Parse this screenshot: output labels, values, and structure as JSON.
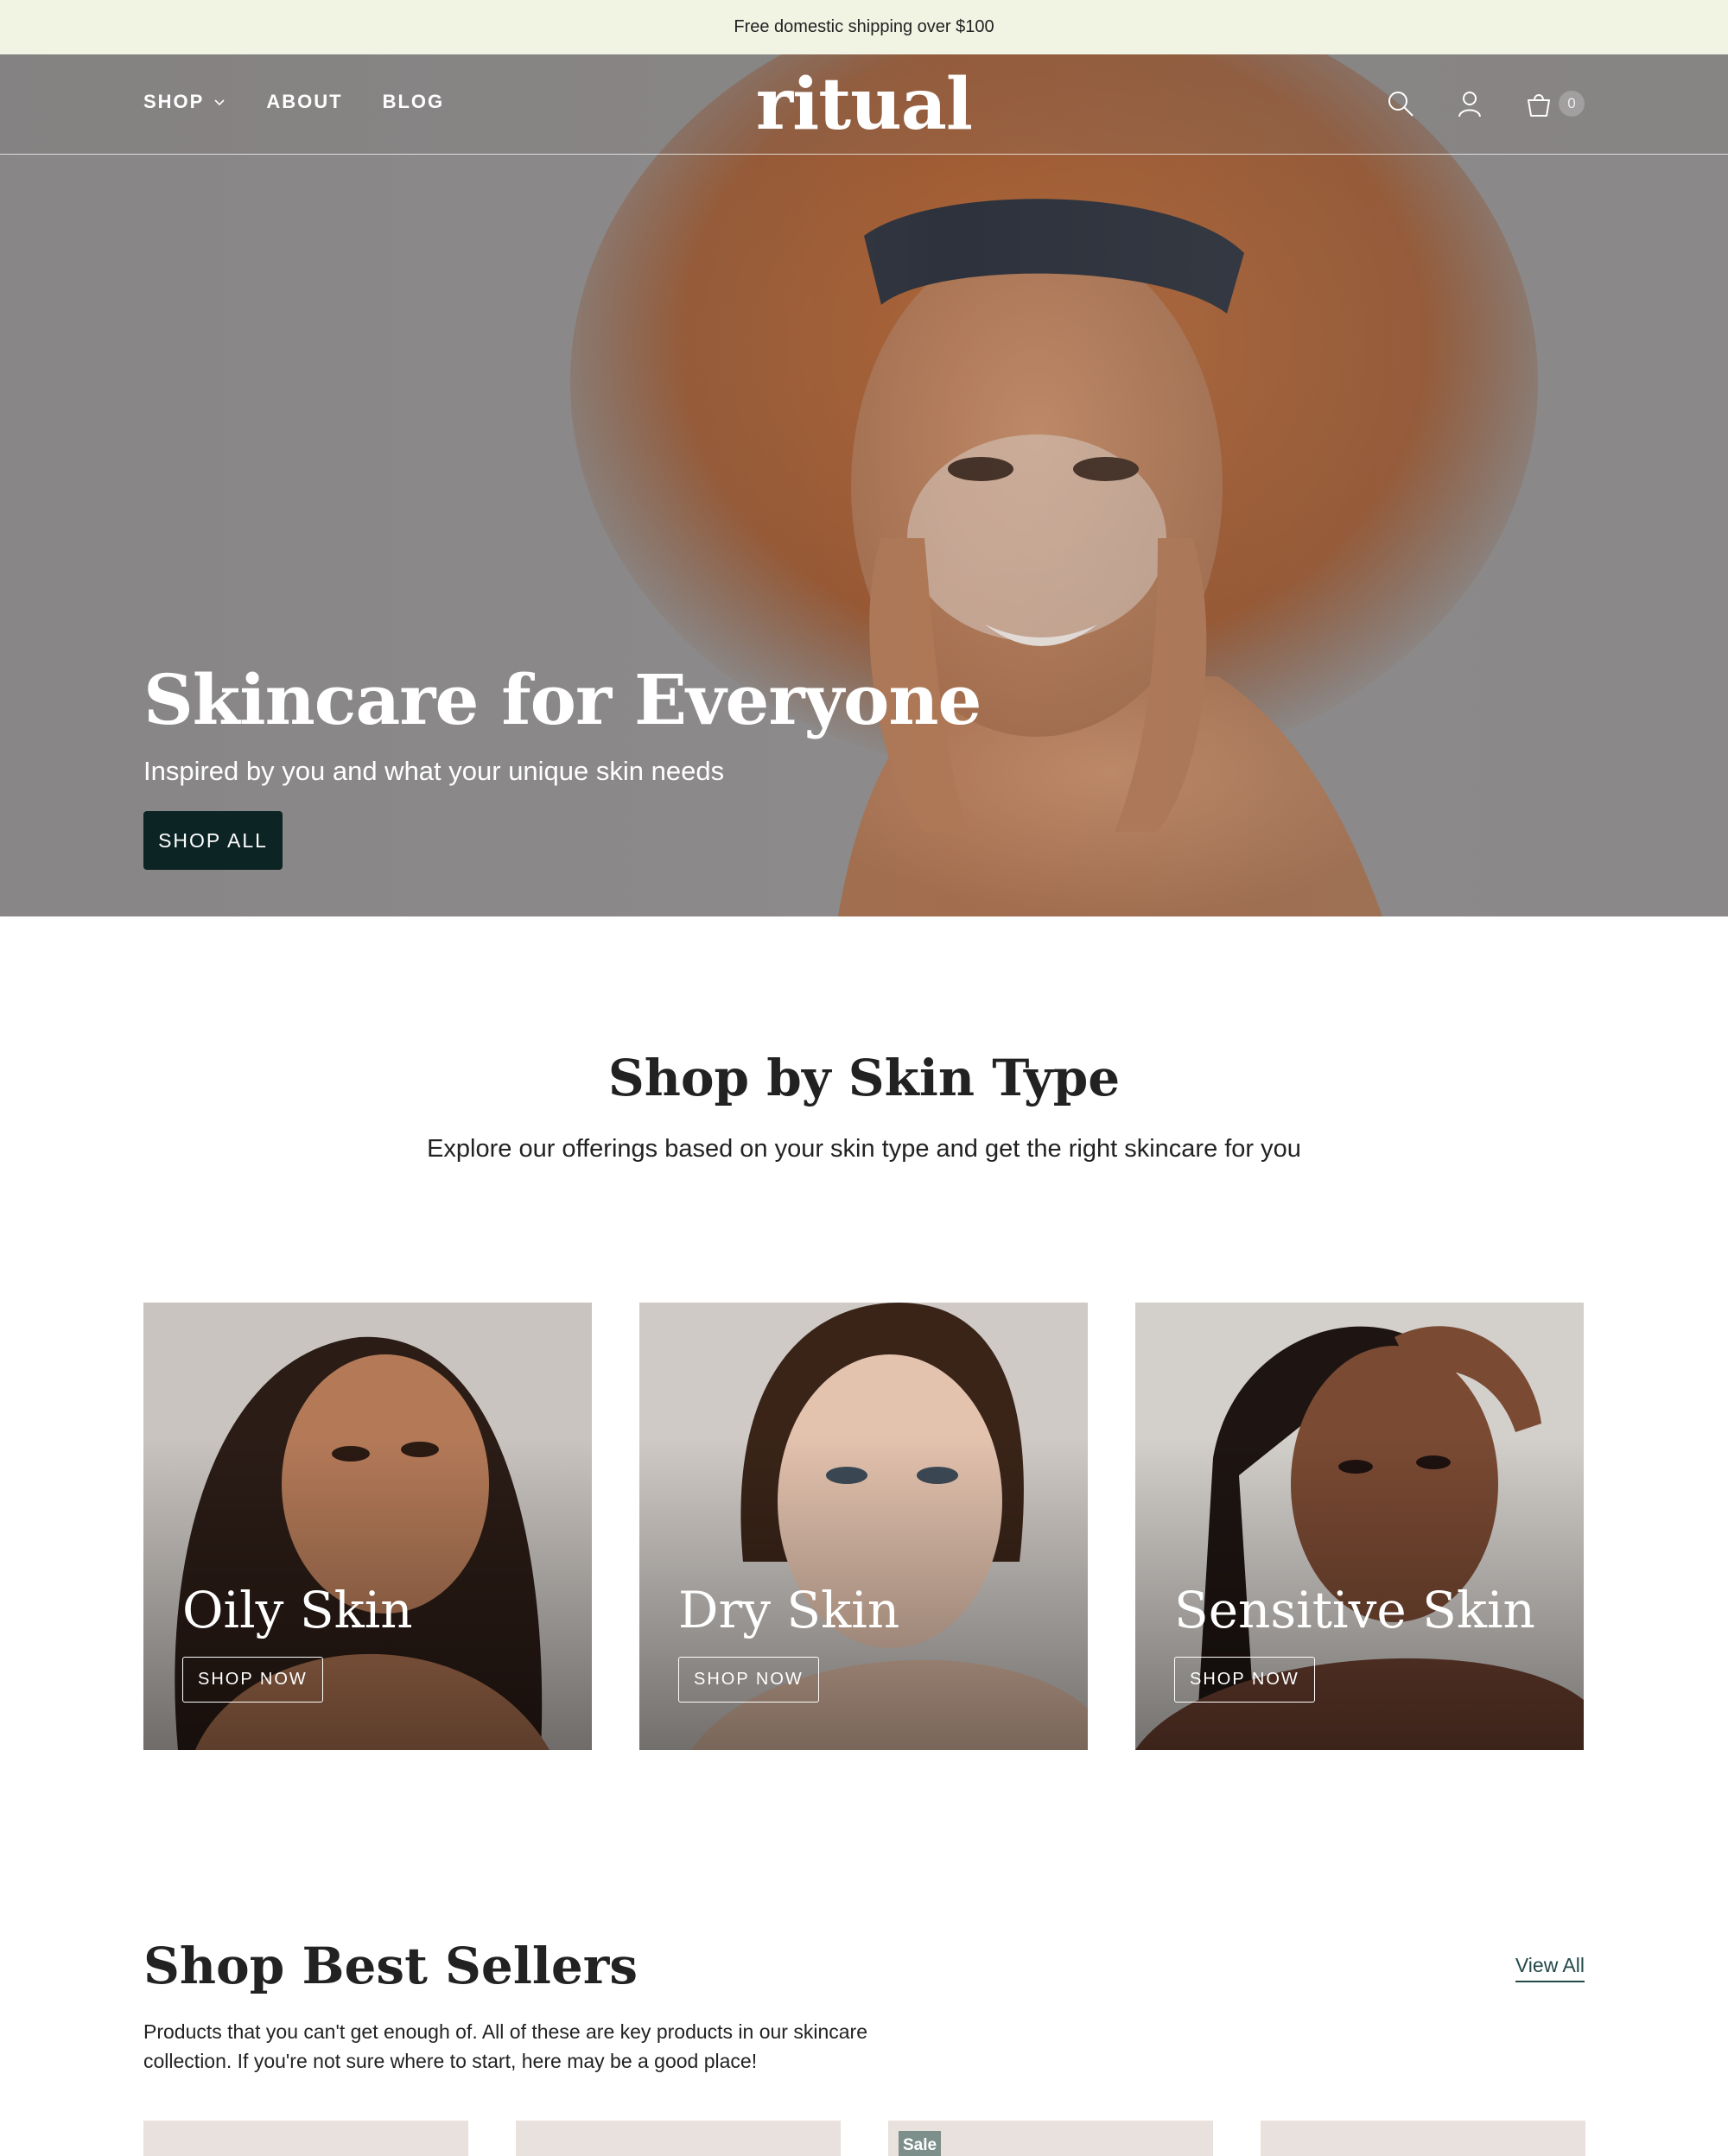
{
  "announcement": {
    "text": "Free domestic shipping over $100"
  },
  "header": {
    "nav": [
      {
        "label": "SHOP",
        "has_dropdown": true
      },
      {
        "label": "ABOUT"
      },
      {
        "label": "BLOG"
      }
    ],
    "logo": "ritual",
    "icons": [
      "search-icon",
      "account-icon",
      "cart-icon"
    ],
    "cart_count": "0"
  },
  "hero": {
    "title": "Skincare for Everyone",
    "subtitle": "Inspired by you and what your unique skin needs",
    "button": "SHOP ALL"
  },
  "skin_type": {
    "title": "Shop by Skin Type",
    "subtitle": "Explore our offerings based on your skin type and get the right skincare for you",
    "cards": [
      {
        "title": "Oily Skin",
        "button": "SHOP NOW"
      },
      {
        "title": "Dry Skin",
        "button": "SHOP NOW"
      },
      {
        "title": "Sensitive Skin",
        "button": "SHOP NOW"
      }
    ]
  },
  "best_sellers": {
    "title": "Shop Best Sellers",
    "view_all": "View All",
    "description": "Products that you can't get enough of. All of these are key products in our skincare collection. If you're not sure where to start, here may be a good place!",
    "badge": "Sale"
  },
  "colors": {
    "announcement_bg": "#f1f3e3",
    "hero_button_bg": "#0d2424",
    "accent_link": "#244a4a",
    "sale_badge": "#7d8f8a",
    "product_placeholder": "#e8e1dd"
  }
}
